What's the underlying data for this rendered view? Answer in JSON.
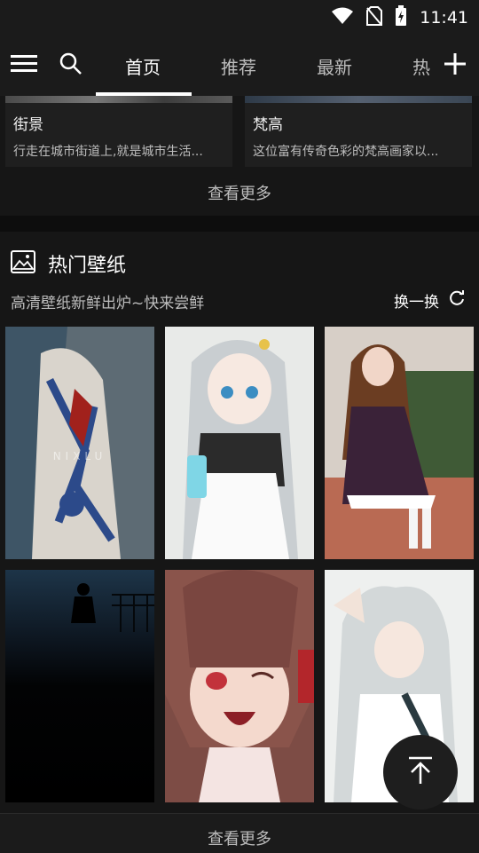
{
  "status": {
    "time": "11:41",
    "icons": [
      "wifi-icon",
      "no-sim-icon",
      "battery-charging-icon"
    ]
  },
  "nav": {
    "menu_icon": "hamburger-menu-icon",
    "search_icon": "search-icon",
    "add_icon": "plus-icon",
    "tabs": [
      {
        "label": "首页",
        "active": true
      },
      {
        "label": "推荐",
        "active": false
      },
      {
        "label": "最新",
        "active": false
      },
      {
        "label": "热",
        "active": false
      }
    ]
  },
  "cards": [
    {
      "title": "街景",
      "desc": "行走在城市街道上,就是城市生活..."
    },
    {
      "title": "梵高",
      "desc": "这位富有传奇色彩的梵高画家以..."
    }
  ],
  "see_more_1": "查看更多",
  "hot": {
    "icon": "image-icon",
    "title": "热门壁纸",
    "subtitle": "高清壁纸新鲜出炉~快来尝鲜",
    "refresh_label": "换一换",
    "refresh_icon": "refresh-icon",
    "watermark": "NIXLU"
  },
  "wallpapers": [
    "wallpaper-blue-tattoo-girl",
    "wallpaper-anime-silver-hair-girl",
    "wallpaper-lolita-dress-girl",
    "wallpaper-dark-silhouette",
    "wallpaper-anime-brown-hair-girl",
    "wallpaper-anime-white-hair-girl"
  ],
  "see_more_2": "查看更多",
  "back_to_top_icon": "back-to-top-icon"
}
